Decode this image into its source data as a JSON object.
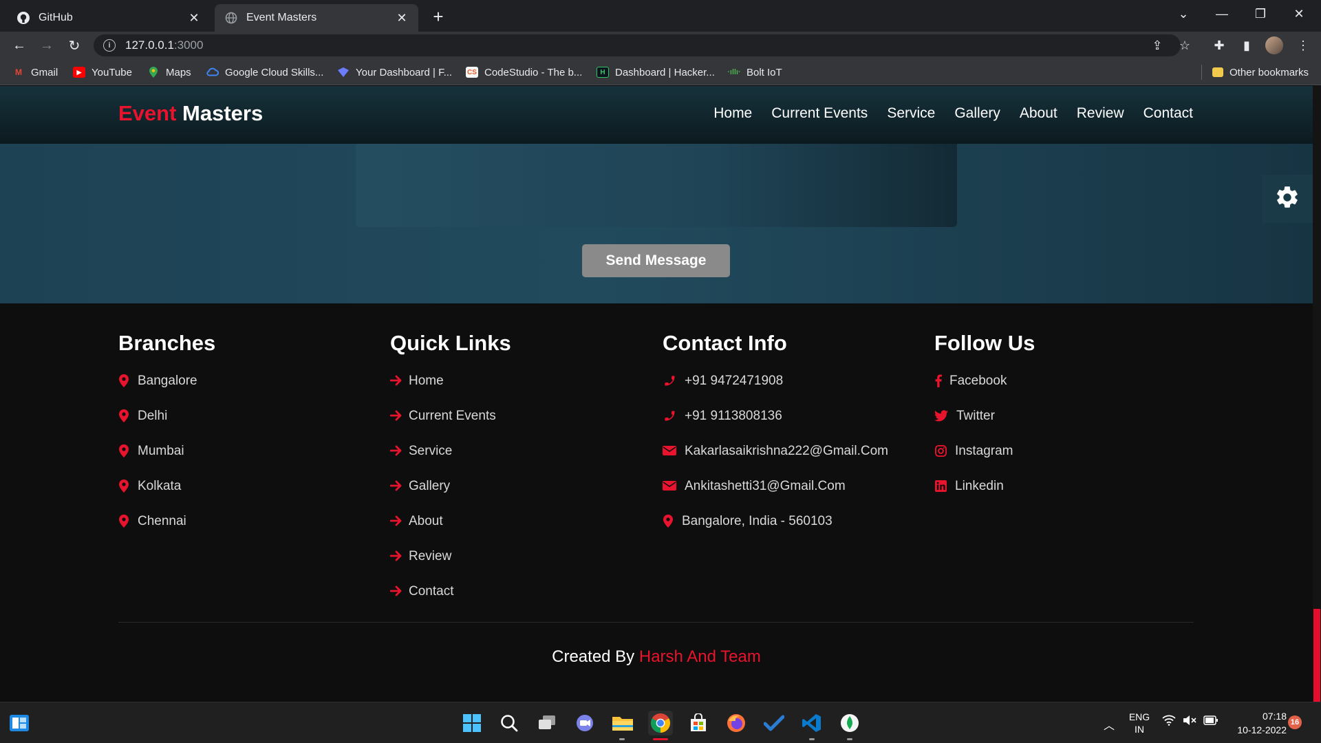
{
  "browser": {
    "tabs": [
      {
        "title": "GitHub",
        "icon": "github-icon"
      },
      {
        "title": "Event Masters",
        "icon": "globe-icon"
      }
    ],
    "url_host": "127.0.0.1",
    "url_port": ":3000",
    "bookmarks": [
      {
        "label": "Gmail",
        "icon": "gmail-icon"
      },
      {
        "label": "YouTube",
        "icon": "youtube-icon"
      },
      {
        "label": "Maps",
        "icon": "maps-icon"
      },
      {
        "label": "Google Cloud Skills...",
        "icon": "google-cloud-icon"
      },
      {
        "label": "Your Dashboard | F...",
        "icon": "dashboard-icon"
      },
      {
        "label": "CodeStudio - The b...",
        "icon": "codestudio-icon"
      },
      {
        "label": "Dashboard | Hacker...",
        "icon": "hackerrank-icon"
      },
      {
        "label": "Bolt IoT",
        "icon": "bolt-iot-icon"
      }
    ],
    "other_bookmarks": "Other bookmarks"
  },
  "site": {
    "logo_accent": "Event",
    "logo_rest": " Masters",
    "nav": [
      "Home",
      "Current Events",
      "Service",
      "Gallery",
      "About",
      "Review",
      "Contact"
    ],
    "send_button": "Send Message"
  },
  "footer": {
    "branches": {
      "title": "Branches",
      "items": [
        "Bangalore",
        "Delhi",
        "Mumbai",
        "Kolkata",
        "Chennai"
      ]
    },
    "quick_links": {
      "title": "Quick Links",
      "items": [
        "Home",
        "Current Events",
        "Service",
        "Gallery",
        "About",
        "Review",
        "Contact"
      ]
    },
    "contact_info": {
      "title": "Contact Info",
      "items": [
        {
          "text": "+91 9472471908",
          "icon": "phone-icon"
        },
        {
          "text": "+91 9113808136",
          "icon": "phone-icon"
        },
        {
          "text": "Kakarlasaikrishna222@Gmail.Com",
          "icon": "envelope-icon"
        },
        {
          "text": "Ankitashetti31@Gmail.Com",
          "icon": "envelope-icon"
        },
        {
          "text": "Bangalore, India - 560103",
          "icon": "map-pin-icon"
        }
      ]
    },
    "follow_us": {
      "title": "Follow Us",
      "items": [
        {
          "text": "Facebook",
          "icon": "facebook-icon"
        },
        {
          "text": "Twitter",
          "icon": "twitter-icon"
        },
        {
          "text": "Instagram",
          "icon": "instagram-icon"
        },
        {
          "text": "Linkedin",
          "icon": "linkedin-icon"
        }
      ]
    },
    "credit_prefix": "Created By ",
    "credit_name": "Harsh And Team"
  },
  "taskbar": {
    "lang_top": "ENG",
    "lang_bottom": "IN",
    "time": "07:18",
    "date": "10-12-2022",
    "notification_count": "16"
  },
  "colors": {
    "accent": "#e8132c",
    "header_bg": "#17323c",
    "footer_bg": "#0e0e0e",
    "button_bg": "#8a8a8a"
  }
}
